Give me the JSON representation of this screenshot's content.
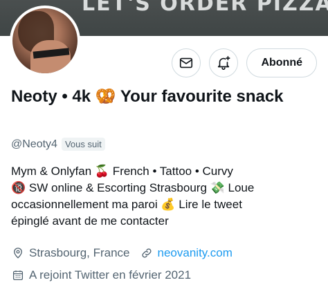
{
  "banner": {
    "text": "LET'S ORDER PIZZA."
  },
  "actions": {
    "follow_label": "Abonné"
  },
  "profile": {
    "name": "Neoty • 4k 🥨 Your favourite snack",
    "handle": "@Neoty4",
    "follows_you": "Vous suit",
    "bio_lines": [
      "Mym & Onlyfan 🍒 French • Tattoo • Curvy",
      "🔞 SW online & Escorting Strasbourg 💸 Loue",
      "occasionnellement ma paroi 💰 Lire le tweet",
      "épinglé avant de me contacter"
    ],
    "location": "Strasbourg, France",
    "website": "neovanity.com",
    "joined": "A rejoint Twitter en février 2021"
  },
  "icons": {
    "message": "mail-icon",
    "notify": "bell-plus-icon",
    "location": "location-pin-icon",
    "website": "link-icon",
    "joined": "calendar-icon"
  },
  "colors": {
    "link": "#1d9bf0",
    "secondary_text": "#536471",
    "border": "#cfd9de"
  }
}
